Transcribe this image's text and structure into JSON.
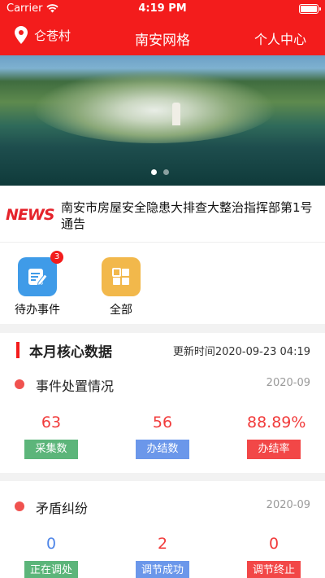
{
  "status_bar": {
    "carrier": "Carrier",
    "time": "4:19 PM"
  },
  "nav": {
    "location": "仑苍村",
    "title": "南安网格",
    "profile": "个人中心"
  },
  "banner": {
    "slides": 2,
    "active_slide": 1
  },
  "news": {
    "logo": "NEWS",
    "headline": "南安市房屋安全隐患大排查大整治指挥部第1号通告"
  },
  "shortcuts": [
    {
      "label": "待办事件",
      "badge": "3",
      "icon": "edit-document-icon",
      "color": "#3f9be8"
    },
    {
      "label": "全部",
      "icon": "grid-icon",
      "color": "#f2b84b"
    }
  ],
  "core_data": {
    "title": "本月核心数据",
    "update_time": "更新时间2020-09-23 04:19",
    "groups": [
      {
        "title": "事件处置情况",
        "date": "2020-09",
        "stats": [
          {
            "value": "63",
            "label": "采集数"
          },
          {
            "value": "56",
            "label": "办结数"
          },
          {
            "value": "88.89%",
            "label": "办结率"
          }
        ]
      },
      {
        "title": "矛盾纠纷",
        "date": "2020-09",
        "stats": [
          {
            "value": "0",
            "label": "正在调处"
          },
          {
            "value": "2",
            "label": "调节成功"
          },
          {
            "value": "0",
            "label": "调节终止"
          }
        ]
      }
    ]
  },
  "colors": {
    "brand_red": "#f31c1c",
    "green": "#5cb57a",
    "blue": "#6b97ea",
    "red": "#f24747"
  }
}
